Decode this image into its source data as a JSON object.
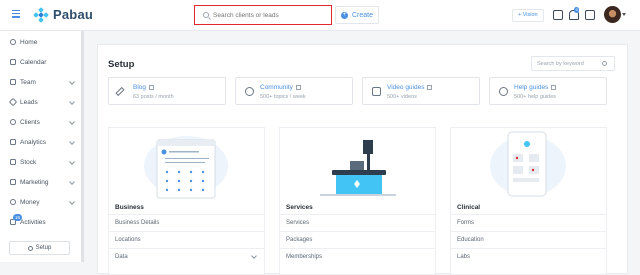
{
  "app": {
    "brand": "Pabau"
  },
  "header": {
    "search_placeholder": "Search clients or leads",
    "create_label": "Create",
    "vision_label": "+ Vision",
    "notification_count": "9"
  },
  "sidebar": {
    "items": [
      {
        "label": "Home",
        "icon": "home-icon",
        "chevron": false
      },
      {
        "label": "Calendar",
        "icon": "calendar-icon",
        "chevron": false
      },
      {
        "label": "Team",
        "icon": "team-icon",
        "chevron": true
      },
      {
        "label": "Leads",
        "icon": "leads-icon",
        "chevron": true
      },
      {
        "label": "Clients",
        "icon": "clients-icon",
        "chevron": true
      },
      {
        "label": "Analytics",
        "icon": "analytics-icon",
        "chevron": true
      },
      {
        "label": "Stock",
        "icon": "stock-icon",
        "chevron": true
      },
      {
        "label": "Marketing",
        "icon": "marketing-icon",
        "chevron": true
      },
      {
        "label": "Money",
        "icon": "money-icon",
        "chevron": true
      },
      {
        "label": "Activities",
        "icon": "activities-icon",
        "chevron": false
      }
    ],
    "activities_badge": "16",
    "setup_button": "Setup"
  },
  "main": {
    "title": "Setup",
    "keyword_search_placeholder": "Search by keyword",
    "resources": [
      {
        "title": "Blog",
        "subtitle": "63 posts / month",
        "icon": "pencil-icon"
      },
      {
        "title": "Community",
        "subtitle": "500+ topics / week",
        "icon": "community-icon"
      },
      {
        "title": "Video guides",
        "subtitle": "500+ videos",
        "icon": "video-icon"
      },
      {
        "title": "Help guides",
        "subtitle": "500+ help guides",
        "icon": "help-icon"
      }
    ],
    "cards": [
      {
        "title": "Business",
        "links": [
          "Business Details",
          "Locations",
          "Data"
        ]
      },
      {
        "title": "Services",
        "links": [
          "Services",
          "Packages",
          "Memberships"
        ]
      },
      {
        "title": "Clinical",
        "links": [
          "Forms",
          "Education",
          "Labs"
        ]
      }
    ]
  },
  "colors": {
    "accent": "#4a90e2",
    "brand_dark": "#2f4e6b",
    "highlight": "#e0282e"
  }
}
